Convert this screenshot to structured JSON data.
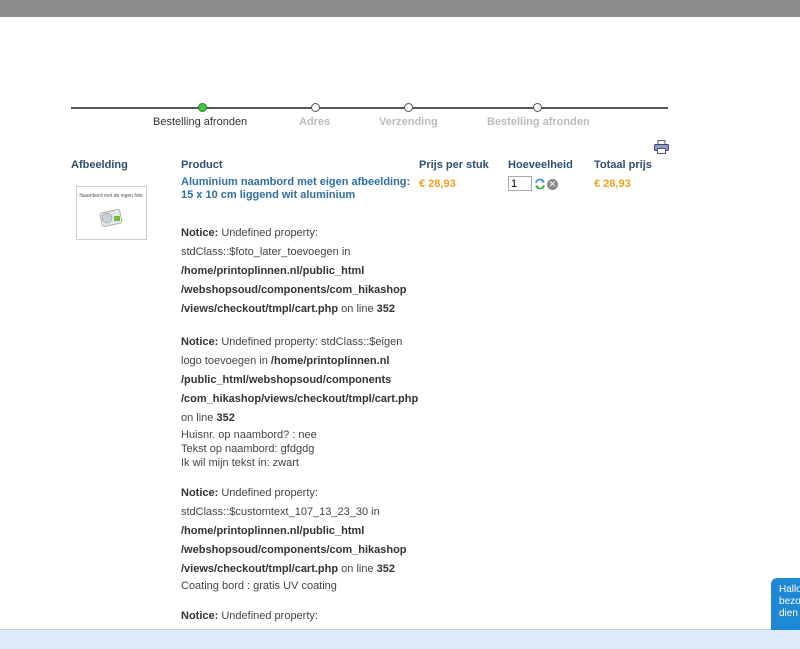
{
  "steps": [
    {
      "label": "Bestelling afronden",
      "active": true
    },
    {
      "label": "Adres",
      "active": false
    },
    {
      "label": "Verzending",
      "active": false
    },
    {
      "label": "Bestelling afronden",
      "active": false
    }
  ],
  "columns": {
    "image": "Afbeelding",
    "product": "Product",
    "unit_price": "Prijs per stuk",
    "quantity": "Hoeveelheid",
    "total": "Totaal prijs"
  },
  "item": {
    "name": "Aluminium naambord met eigen afbeelding: 15 x 10 cm liggend wit aluminium",
    "unit_price": "€ 28,93",
    "quantity": "1",
    "total": "€ 28,93",
    "thumb_text": "Naambord met de eigen foto"
  },
  "notices": [
    {
      "lines": [
        [
          {
            "t": "Notice:",
            "b": true
          },
          {
            "t": " Undefined property:",
            "b": false
          }
        ],
        [
          {
            "t": "stdClass::$foto_later_toevoegen in",
            "b": false
          }
        ],
        [
          {
            "t": "/home/printoplinnen.nl/public_html",
            "b": true
          }
        ],
        [
          {
            "t": "/webshopsoud/components/com_hikashop",
            "b": true
          }
        ],
        [
          {
            "t": "/views/checkout/tmpl/cart.php",
            "b": true
          },
          {
            "t": " on line ",
            "b": false
          },
          {
            "t": "352",
            "b": true
          }
        ]
      ],
      "options": []
    },
    {
      "lines": [
        [
          {
            "t": "Notice:",
            "b": true
          },
          {
            "t": " Undefined property: stdClass::$eigen",
            "b": false
          }
        ],
        [
          {
            "t": "logo toevoegen in ",
            "b": false
          },
          {
            "t": "/home/printoplinnen.nl",
            "b": true
          }
        ],
        [
          {
            "t": "/public_html/webshopsoud/components",
            "b": true
          }
        ],
        [
          {
            "t": "/com_hikashop/views/checkout/tmpl/cart.php",
            "b": true
          }
        ],
        [
          {
            "t": "on line ",
            "b": false
          },
          {
            "t": "352",
            "b": true
          }
        ]
      ],
      "options": [
        "Huisnr. op naambord? : nee",
        "Tekst op naambord: gfdgdg",
        "Ik wil mijn tekst in: zwart"
      ]
    },
    {
      "lines": [
        [
          {
            "t": "Notice:",
            "b": true
          },
          {
            "t": " Undefined property:",
            "b": false
          }
        ],
        [
          {
            "t": "stdClass::$customtext_107_13_23_30 in",
            "b": false
          }
        ],
        [
          {
            "t": "/home/printoplinnen.nl/public_html",
            "b": true
          }
        ],
        [
          {
            "t": "/webshopsoud/components/com_hikashop",
            "b": true
          }
        ],
        [
          {
            "t": "/views/checkout/tmpl/cart.php",
            "b": true
          },
          {
            "t": " on line ",
            "b": false
          },
          {
            "t": "352",
            "b": true
          }
        ]
      ],
      "options": [
        "Coating bord : gratis UV coating"
      ]
    },
    {
      "lines": [
        [
          {
            "t": "Notice:",
            "b": true
          },
          {
            "t": " Undefined property:",
            "b": false
          }
        ]
      ],
      "options": []
    }
  ],
  "chat": {
    "text": "Hallo bezo dien"
  },
  "colors": {
    "accent": "#2e6ea0",
    "price": "#f0a020",
    "active_step": "#3cc93c"
  },
  "icons": {
    "print": "printer-icon",
    "refresh": "refresh-icon",
    "delete": "delete-icon"
  }
}
